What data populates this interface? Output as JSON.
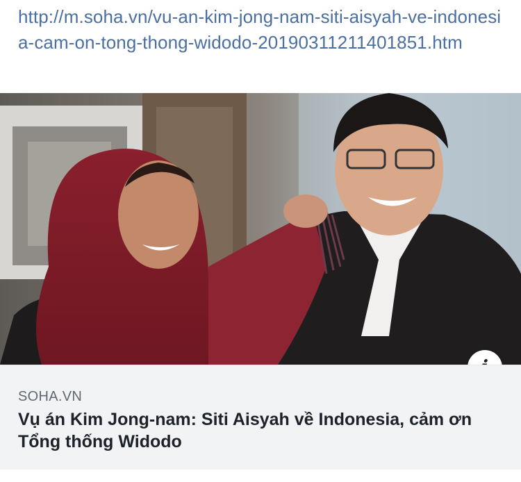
{
  "link": {
    "url": "http://m.soha.vn/vu-an-kim-jong-nam-siti-aisyah-ve-indonesia-cam-on-tong-thong-widodo-20190311211401851.htm"
  },
  "preview": {
    "image_icon": "news-photo",
    "info_icon_glyph": "i",
    "source": "SOHA.VN",
    "headline": "Vụ án Kim Jong-nam: Siti Aisyah về Indonesia, cảm ơn Tổng thống Widodo"
  },
  "colors": {
    "link": "#4b6fa0",
    "caption_bg": "#f2f3f5",
    "headline": "#1d2129",
    "source": "#606770"
  }
}
